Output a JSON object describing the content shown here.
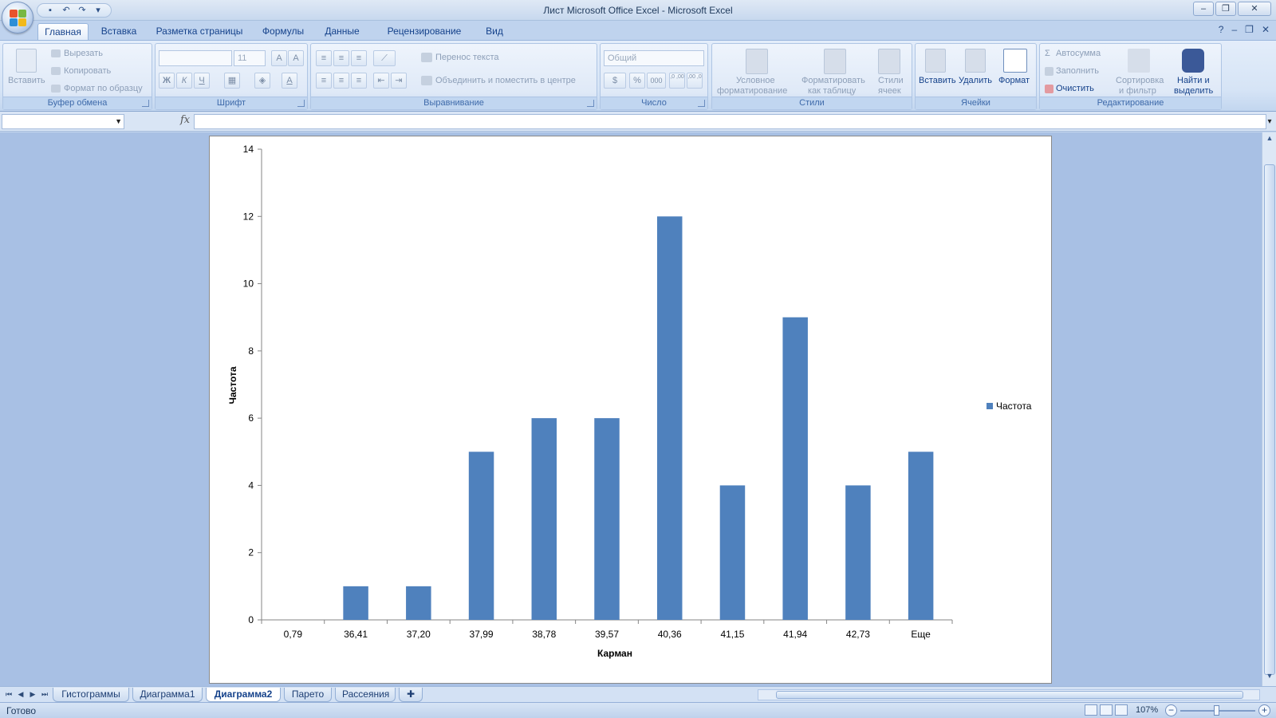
{
  "window": {
    "title": "Лист Microsoft Office Excel - Microsoft Excel",
    "controls": [
      "–",
      "❐",
      "✕"
    ]
  },
  "ribbon": {
    "tabs": [
      "Главная",
      "Вставка",
      "Разметка страницы",
      "Формулы",
      "Данные",
      "Рецензирование",
      "Вид"
    ],
    "active_tab": "Главная",
    "clipboard": {
      "label": "Буфер обмена",
      "paste": "Вставить",
      "cut": "Вырезать",
      "copy": "Копировать",
      "format_painter": "Формат по образцу"
    },
    "font": {
      "label": "Шрифт",
      "font_size": "11",
      "bold": "Ж",
      "italic": "К",
      "underline": "Ч",
      "grow": "A",
      "shrink": "A",
      "font_color": "A"
    },
    "alignment": {
      "label": "Выравнивание",
      "wrap": "Перенос текста",
      "merge": "Объединить и поместить в центре"
    },
    "number": {
      "label": "Число",
      "format": "Общий",
      "percent": "%",
      "thousands": "000",
      "inc_decimal": ",0 ,00",
      "dec_decimal": ",00 ,0"
    },
    "styles": {
      "label": "Стили",
      "conditional_1": "Условное",
      "conditional_2": "форматирование",
      "format_table_1": "Форматировать",
      "format_table_2": "как таблицу",
      "cell_styles_1": "Стили",
      "cell_styles_2": "ячеек"
    },
    "cells": {
      "label": "Ячейки",
      "insert": "Вставить",
      "delete": "Удалить",
      "format": "Формат"
    },
    "editing": {
      "label": "Редактирование",
      "autosum": "Автосумма",
      "fill": "Заполнить",
      "clear": "Очистить",
      "sort_1": "Сортировка",
      "sort_2": "и фильтр",
      "find_1": "Найти и",
      "find_2": "выделить"
    }
  },
  "formula_bar": {
    "name_box": "",
    "fx": "fx",
    "formula": ""
  },
  "chart_data": {
    "type": "bar",
    "categories": [
      "0,79",
      "36,41",
      "37,20",
      "37,99",
      "38,78",
      "39,57",
      "40,36",
      "41,15",
      "41,94",
      "42,73",
      "Еще"
    ],
    "series": [
      {
        "name": "Частота",
        "values": [
          0,
          1,
          1,
          5,
          6,
          6,
          12,
          4,
          9,
          4,
          5
        ],
        "color": "#4f81bd"
      }
    ],
    "xlabel": "Карман",
    "ylabel": "Частота",
    "ylim": [
      0,
      14
    ],
    "yticks": [
      "0",
      "2",
      "4",
      "6",
      "8",
      "10",
      "12",
      "14"
    ],
    "legend": "right",
    "grid": false
  },
  "sheets": {
    "tabs": [
      "Гистограммы",
      "Диаграмма1",
      "Диаграмма2",
      "Парето",
      "Рассеяния"
    ],
    "active": "Диаграмма2",
    "nav": [
      "⏮",
      "◀",
      "▶",
      "⏭"
    ]
  },
  "status": {
    "text": "Готово",
    "zoom": "107%",
    "zoom_out": "−",
    "zoom_in": "+"
  }
}
